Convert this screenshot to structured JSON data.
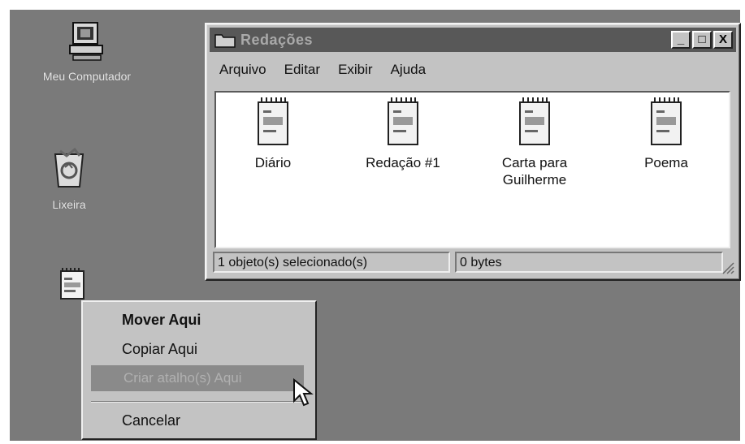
{
  "desktop": {
    "icons": [
      {
        "label": "Meu Computador",
        "icon": "my-computer-icon"
      },
      {
        "label": "Lixeira",
        "icon": "recycle-bin-icon"
      },
      {
        "label": "",
        "icon": "document-icon"
      }
    ],
    "background": "#7a7a7a"
  },
  "window": {
    "title": "Redações",
    "buttons": {
      "minimize": "_",
      "maximize": "□",
      "close": "X"
    },
    "menu": [
      "Arquivo",
      "Editar",
      "Exibir",
      "Ajuda"
    ],
    "files": [
      "Diário",
      "Redação #1",
      "Carta para Guilherme",
      "Poema"
    ],
    "status": {
      "selection": "1 objeto(s) selecionado(s)",
      "size": "0 bytes"
    }
  },
  "context_menu": {
    "items": [
      "Mover Aqui",
      "Copiar Aqui",
      "Criar atalho(s) Aqui",
      "Cancelar"
    ],
    "default_item": "Mover Aqui",
    "highlighted_item": "Criar atalho(s) Aqui"
  }
}
